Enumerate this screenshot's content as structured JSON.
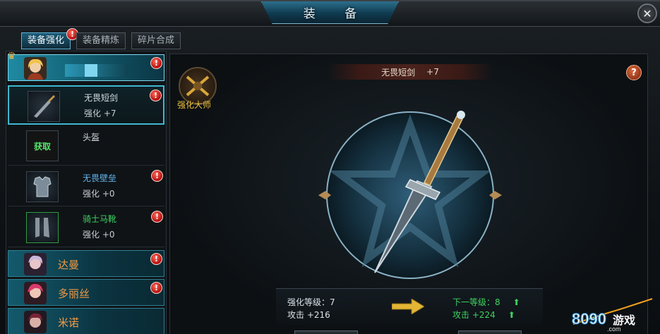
{
  "window": {
    "title": "装 备",
    "close_label": "✕"
  },
  "tabs": [
    {
      "label": "装备强化",
      "active": true,
      "alert": "!"
    },
    {
      "label": "装备精炼",
      "active": false
    },
    {
      "label": "碎片合成",
      "active": false
    }
  ],
  "heroes": [
    {
      "name": "",
      "selected": true,
      "alert": "!"
    },
    {
      "name": "达曼",
      "selected": false,
      "alert": "!"
    },
    {
      "name": "多丽丝",
      "selected": false,
      "alert": "!"
    },
    {
      "name": "米诺",
      "selected": false
    }
  ],
  "equipment": [
    {
      "name": "无畏短剑",
      "level": "强化 +7",
      "color": "white",
      "alert": "!",
      "selected": true
    },
    {
      "name": "头盔",
      "level": "",
      "color": "white",
      "get_label": "获取"
    },
    {
      "name": "无畏壁垒",
      "level": "强化 +0",
      "color": "blue",
      "alert": "!"
    },
    {
      "name": "骑士马靴",
      "level": "强化 +0",
      "color": "green",
      "alert": "!"
    }
  ],
  "main": {
    "item_name": "无畏短剑",
    "item_level": "+7",
    "help_label": "?",
    "master_label": "强化大师",
    "current": {
      "level_label": "强化等级：7",
      "attack_label": "攻击  +216"
    },
    "next": {
      "level_label": "下一等级：8",
      "attack_label": "攻击  +224"
    }
  },
  "watermark": {
    "number": "8090",
    "text": "游戏",
    "domain": ".com"
  },
  "colors": {
    "accent": "#1f8aa3",
    "hero_name": "#f39a45",
    "upgrade_green": "#3fd260",
    "alert_red": "#b40d0d"
  }
}
